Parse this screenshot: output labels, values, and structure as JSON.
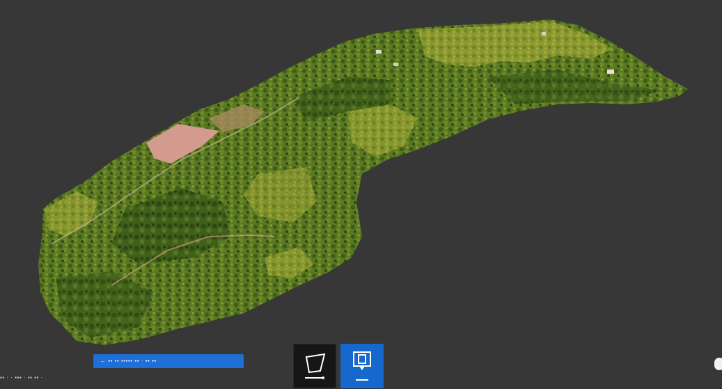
{
  "viewport": {
    "scene": "3d-terrain-model",
    "background_color": "#373737"
  },
  "colors": {
    "terrain_dark": "#3c5a1a",
    "terrain_mid": "#5d7a23",
    "terrain_light": "#8a9a2e",
    "terrain_yellow": "#a6a63a",
    "bare_ground": "#d39a8e",
    "accent_blue": "#1f6fd6"
  },
  "status_bar": {
    "text": "← ▪▪ ▪▪ ▪▪▪▪▪ ▪▪ · ▪▪ ▪▪"
  },
  "coordinates": {
    "text": "▪▪ · · ▪▪▪ · ▪▪ ▪▪ ·"
  },
  "toolbar": {
    "tools": [
      {
        "name": "polygon-measure",
        "icon": "polygon-icon",
        "active": false
      },
      {
        "name": "point-measure",
        "icon": "point-marker-icon",
        "active": true
      }
    ]
  }
}
